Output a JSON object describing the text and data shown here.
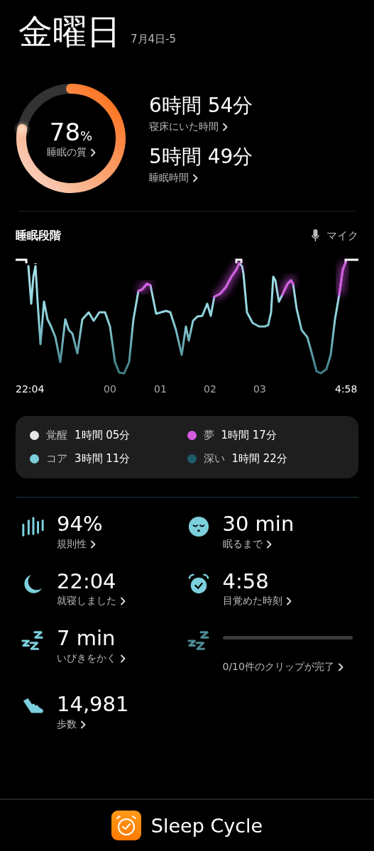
{
  "header": {
    "title": "金曜日",
    "date": "7月4日-5"
  },
  "quality": {
    "value": "78",
    "unit": "%",
    "label": "睡眠の質"
  },
  "durations": [
    {
      "value": "6時間 54分",
      "label": "寝床にいた時間"
    },
    {
      "value": "5時間 49分",
      "label": "睡眠時間"
    }
  ],
  "stages": {
    "title": "睡眠段階",
    "mic_label": "マイク",
    "time_labels": [
      "22:04",
      "00",
      "01",
      "02",
      "03",
      "4:58"
    ],
    "legend": [
      {
        "name": "覚醒",
        "duration": "1時間 05分",
        "color": "#e6e6e6"
      },
      {
        "name": "夢",
        "duration": "1時間 17分",
        "color": "#d35ce0"
      },
      {
        "name": "コア",
        "duration": "3時間 11分",
        "color": "#7ccfdc"
      },
      {
        "name": "深い",
        "duration": "1時間 22分",
        "color": "#1f5a66"
      }
    ]
  },
  "stats": [
    {
      "kind": "stat",
      "value": "94%",
      "label": "規則性"
    },
    {
      "kind": "stat",
      "value": "30 min",
      "label": "眠るまで"
    },
    {
      "kind": "stat",
      "value": "22:04",
      "label": "就寝しました"
    },
    {
      "kind": "stat",
      "value": "4:58",
      "label": "目覚めた時刻"
    },
    {
      "kind": "stat",
      "value": "7 min",
      "label": "いびきをかく"
    },
    {
      "kind": "clips",
      "label": "0/10件のクリップが完了",
      "level": 0
    },
    {
      "kind": "stat",
      "value": "14,981",
      "label": "歩数"
    }
  ],
  "footer": {
    "app_name": "Sleep Cycle"
  }
}
